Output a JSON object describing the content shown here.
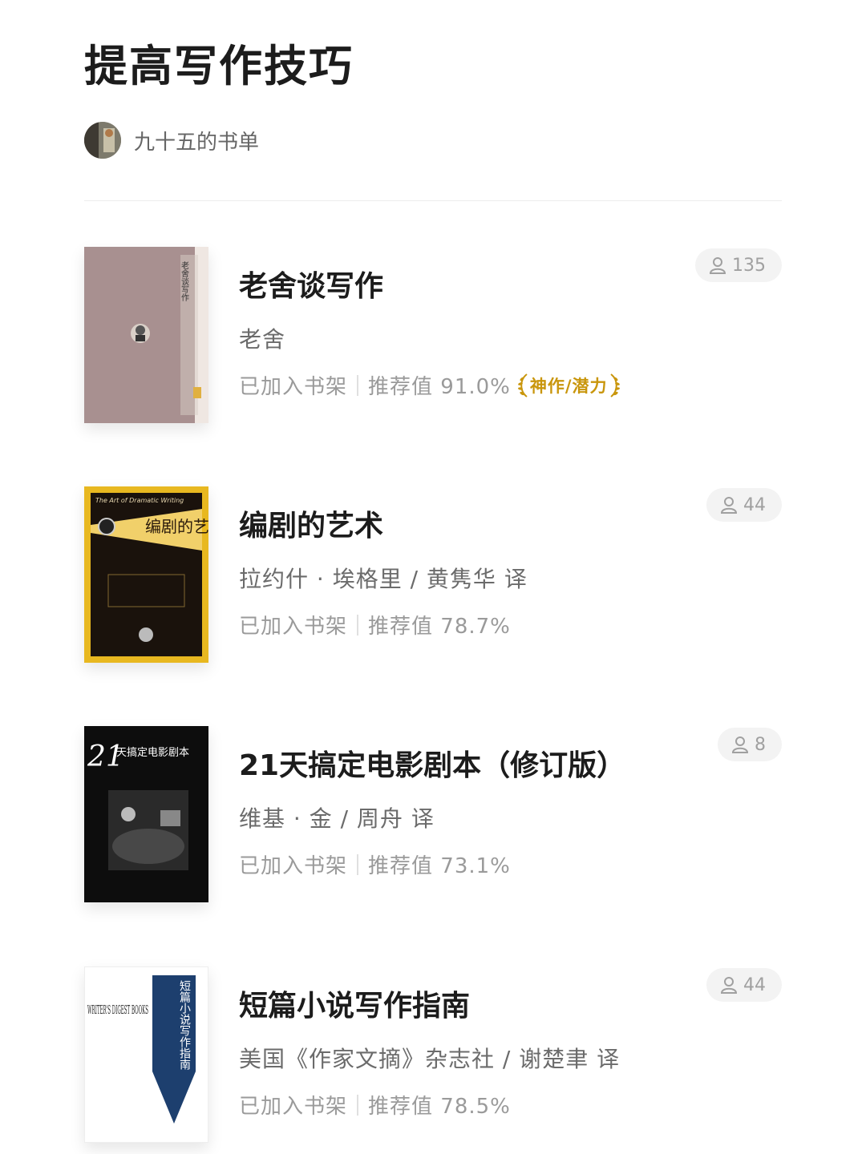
{
  "header": {
    "title": "提高写作技巧",
    "author_name": "九十五的书单"
  },
  "books": [
    {
      "title": "老舍谈写作",
      "author": "老舍",
      "status": "已加入书架",
      "recommend": "推荐值 91.0%",
      "badge": "神作/潜力",
      "readers": "135",
      "cover": {
        "text": "老舍谈写作",
        "bg": "#a89090"
      }
    },
    {
      "title": "编剧的艺术",
      "author": "拉约什 · 埃格里 / 黄隽华 译",
      "status": "已加入书架",
      "recommend": "推荐值 78.7%",
      "readers": "44",
      "cover": {
        "text_en": "The Art of Dramatic Writing",
        "text": "编剧的艺术",
        "bg": "#e8b820"
      }
    },
    {
      "title": "21天搞定电影剧本（修订版）",
      "author": "维基 · 金 / 周舟 译",
      "status": "已加入书架",
      "recommend": "推荐值 73.1%",
      "readers": "8",
      "cover": {
        "number": "21",
        "text": "天搞定电影剧本",
        "bg": "#0d0d0d"
      }
    },
    {
      "title": "短篇小说写作指南",
      "author": "美国《作家文摘》杂志社 / 谢楚聿 译",
      "status": "已加入书架",
      "recommend": "推荐值 78.5%",
      "readers": "44",
      "cover": {
        "text_en": "WRITER'S DIGEST BOOKS",
        "text": "短篇小说写作指南",
        "bg": "#ffffff",
        "accent": "#1d3f6e"
      }
    }
  ],
  "colors": {
    "badge": "#c9960c",
    "pill_bg": "#f3f3f3"
  }
}
